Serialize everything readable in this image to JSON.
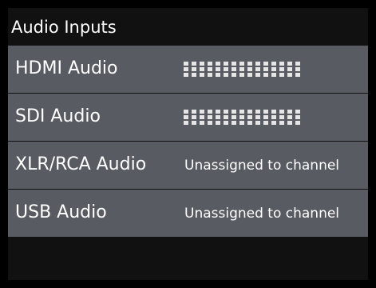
{
  "header": {
    "title": "Audio Inputs"
  },
  "rows": [
    {
      "label": "HDMI Audio",
      "type": "meter",
      "level": 0,
      "segments": 15
    },
    {
      "label": "SDI Audio",
      "type": "meter",
      "level": 0,
      "segments": 15
    },
    {
      "label": "XLR/RCA Audio",
      "type": "status",
      "status": "Unassigned to channel"
    },
    {
      "label": "USB Audio",
      "type": "status",
      "status": "Unassigned to channel"
    }
  ],
  "colors": {
    "background": "#000000",
    "panel": "#111111",
    "row": "#585b61",
    "text": "#ffffff",
    "meter_idle": "#e6e6e6"
  }
}
